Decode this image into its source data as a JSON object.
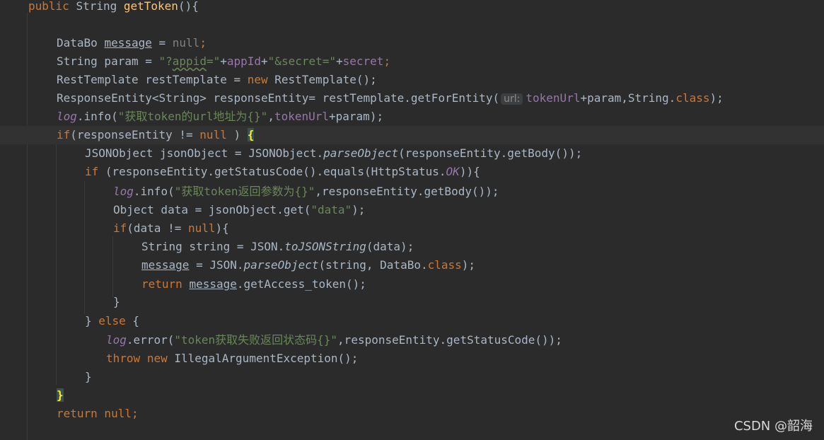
{
  "editor": {
    "lines": [
      "public String getToken(){",
      "",
      "    DataBo message = null;",
      "    String param = \"?appid=\"+appId+\"&secret=\"+secret;",
      "    RestTemplate restTemplate = new RestTemplate();",
      "    ResponseEntity<String> responseEntity= restTemplate.getForEntity( url: tokenUrl+param,String.class);",
      "    log.info(\"获取token的url地址为{}\",tokenUrl+param);",
      "    if(responseEntity != null ) {",
      "        JSONObject jsonObject = JSONObject.parseObject(responseEntity.getBody());",
      "        if (responseEntity.getStatusCode().equals(HttpStatus.OK)){",
      "            log.info(\"获取token返回参数为{}\",responseEntity.getBody());",
      "            Object data = jsonObject.get(\"data\");",
      "            if(data != null){",
      "                String string = JSON.toJSONString(data);",
      "                message = JSON.parseObject(string, DataBo.class);",
      "                return message.getAccess_token();",
      "            }",
      "        } else {",
      "           log.error(\"token获取失败返回状态码{}\",responseEntity.getStatusCode());",
      "           throw new IllegalArgumentException();",
      "        }",
      "    }",
      "    return null;"
    ],
    "t": {
      "public": "public",
      "String": "String",
      "getToken": "getToken",
      "sig_tail": "(){",
      "DataBo": "DataBo",
      "message": "message",
      "eq": " = ",
      "null": "null",
      "semi": ";",
      "param_decl": "String param = ",
      "q": "\"",
      "appid_q": "?",
      "appid": "appid",
      "eq_q": "=\"",
      "plus": "+",
      "appId": "appId",
      "secret_str": "\"&secret=\"",
      "secret": "secret",
      "rt_decl": "RestTemplate restTemplate = ",
      "new": "new",
      "rt_ctor": " RestTemplate();",
      "re_decl": "ResponseEntity<String> responseEntity= restTemplate.getForEntity(",
      "url_hint": "url:",
      "tokenUrl": "tokenUrl",
      "plus_param": "+param,String.",
      "class": "class",
      "close_semi": ");",
      "log": "log",
      "info": ".info(",
      "str1": "\"获取token的url地址为{}\"",
      "comma": ",",
      "param_close": "+param);",
      "if": "if",
      "if_cond": "(responseEntity != ",
      "null_sp": " ) ",
      "brace_open": "{",
      "json_decl": "JSONObject jsonObject = JSONObject.",
      "parseObject": "parseObject",
      "getbody_close": "(responseEntity.getBody());",
      "if_status": " (responseEntity.getStatusCode().equals(HttpStatus.",
      "OK": "OK",
      "close2": ")){",
      "str2": "\"获取token返回参数为{}\"",
      "getbody_semi": ",responseEntity.getBody());",
      "obj_decl": "Object data = jsonObject.get(",
      "str_data": "\"data\"",
      "close_semi2": ");",
      "data_ne": "(data != ",
      "close_brace": "){",
      "str_decl": "String string = JSON.",
      "toJSONString": "toJSONString",
      "data_arg": "(data);",
      "json_dot": " = JSON.",
      "string_arg": "(string, DataBo.",
      "return": "return",
      "getaccess": ".getAccess_token();",
      "rbrace": "}",
      "else": "else",
      "rbrace_sp": "} ",
      "sp_lbrace": " {",
      "error": ".error(",
      "str3": "\"token获取失败返回状态码{}\"",
      "status_semi": ",responseEntity.getStatusCode());",
      "throw": "throw",
      "iae": " IllegalArgumentException();",
      "return_null": " null;",
      "sp": " "
    }
  },
  "watermark": "CSDN @韶海"
}
